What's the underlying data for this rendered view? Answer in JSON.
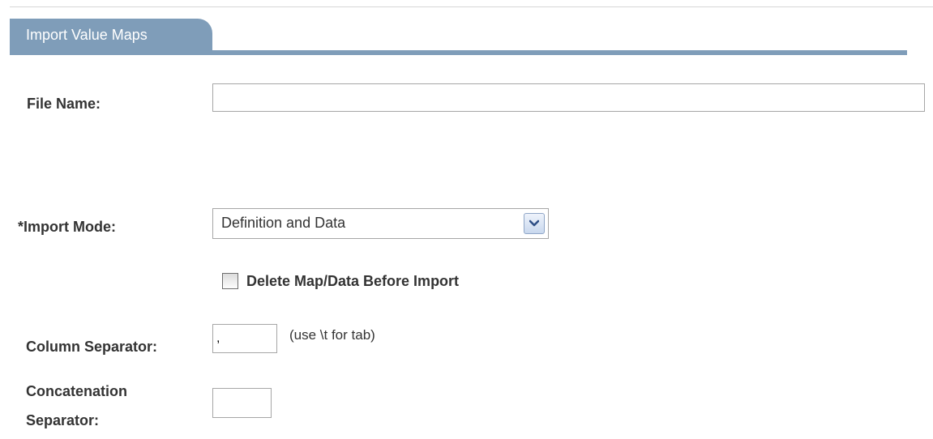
{
  "tab": {
    "label": "Import Value Maps"
  },
  "form": {
    "file_name": {
      "label": "File Name:",
      "value": ""
    },
    "import_mode": {
      "label": "*Import Mode:",
      "selected": "Definition and Data"
    },
    "delete_before_import": {
      "label": "Delete Map/Data Before Import",
      "checked": false
    },
    "column_separator": {
      "label": "Column Separator:",
      "value": ",",
      "hint": "(use \\t for tab)"
    },
    "concatenation_separator": {
      "label_line1": "Concatenation",
      "label_line2": "Separator:",
      "value": ""
    }
  },
  "colors": {
    "tab_blue": "#7f9db9",
    "label_text": "#333333"
  },
  "icons": {
    "select_arrow": "chevron-down-icon"
  }
}
